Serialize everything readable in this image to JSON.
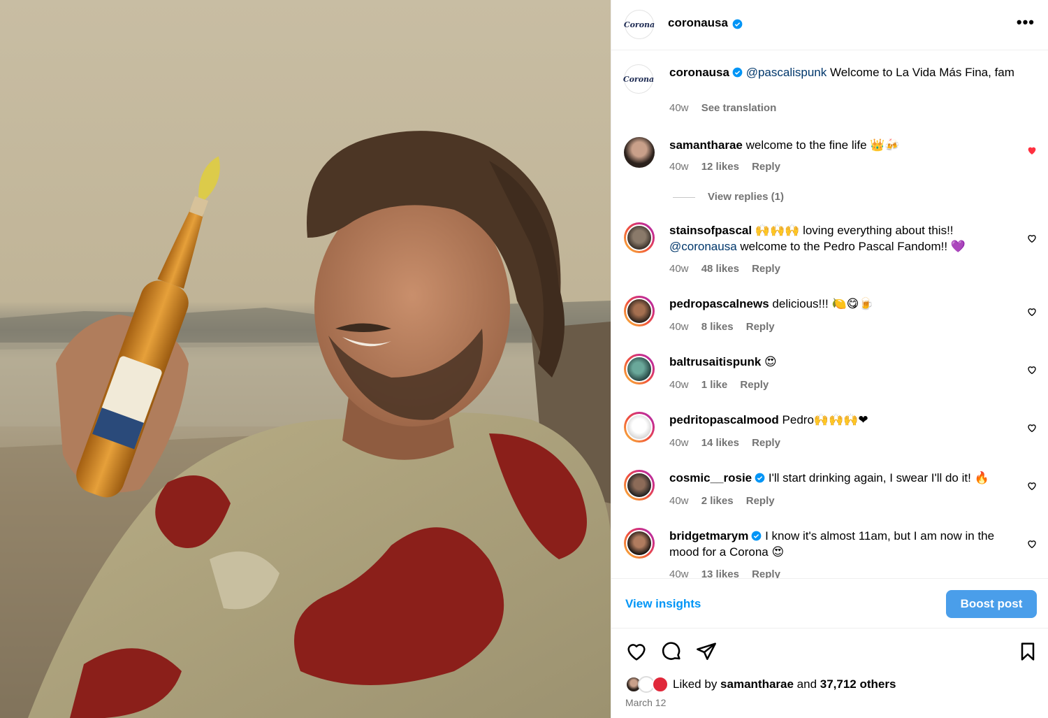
{
  "post": {
    "author": "coronausa",
    "author_logo_text": "Corona",
    "more_icon": "more-horizontal-icon"
  },
  "caption": {
    "username": "coronausa",
    "mention": "@pascalispunk",
    "text": " Welcome to La Vida Más Fina, fam",
    "time": "40w",
    "see_translation": "See translation"
  },
  "comments": [
    {
      "username": "samantharae",
      "verified": false,
      "mention": "",
      "text": "welcome to the fine life 👑🍻",
      "time": "40w",
      "likes": "12 likes",
      "reply": "Reply",
      "liked": true,
      "view_replies": "View replies (1)"
    },
    {
      "username": "stainsofpascal",
      "verified": false,
      "mention": "",
      "text": "🙌🙌🙌 loving everything about this!! ",
      "mention2": "@coronausa",
      "text2": " welcome to the Pedro Pascal Fandom!! 💜",
      "time": "40w",
      "likes": "48 likes",
      "reply": "Reply",
      "liked": false
    },
    {
      "username": "pedropascalnews",
      "verified": false,
      "mention": "",
      "text": "delicious!!! 🍋😋🍺",
      "time": "40w",
      "likes": "8 likes",
      "reply": "Reply",
      "liked": false
    },
    {
      "username": "baltrusaitispunk",
      "verified": false,
      "mention": "",
      "text": "😍",
      "time": "40w",
      "likes": "1 like",
      "reply": "Reply",
      "liked": false
    },
    {
      "username": "pedritopascalmood",
      "verified": false,
      "mention": "",
      "text": "Pedro🙌🙌🙌❤",
      "time": "40w",
      "likes": "14 likes",
      "reply": "Reply",
      "liked": false
    },
    {
      "username": "cosmic__rosie",
      "verified": true,
      "mention": "",
      "text": "I'll start drinking again, I swear I'll do it! 🔥",
      "time": "40w",
      "likes": "2 likes",
      "reply": "Reply",
      "liked": false
    },
    {
      "username": "bridgetmarym",
      "verified": true,
      "mention": "",
      "text": "I know it's almost 11am, but I am now in the mood for a Corona 😍",
      "time": "40w",
      "likes": "13 likes",
      "reply": "Reply",
      "liked": false
    }
  ],
  "footer": {
    "view_insights": "View insights",
    "boost_post": "Boost post",
    "liked_by_prefix": "Liked by ",
    "liked_by_user": "samantharae",
    "liked_by_mid": " and ",
    "liked_by_count": "37,712 others",
    "date": "March 12"
  },
  "colors": {
    "accent": "#0095f6",
    "boost": "#4a9eea",
    "liked_heart": "#ff3040",
    "verified": "#0095f6",
    "mention": "#00376b"
  }
}
